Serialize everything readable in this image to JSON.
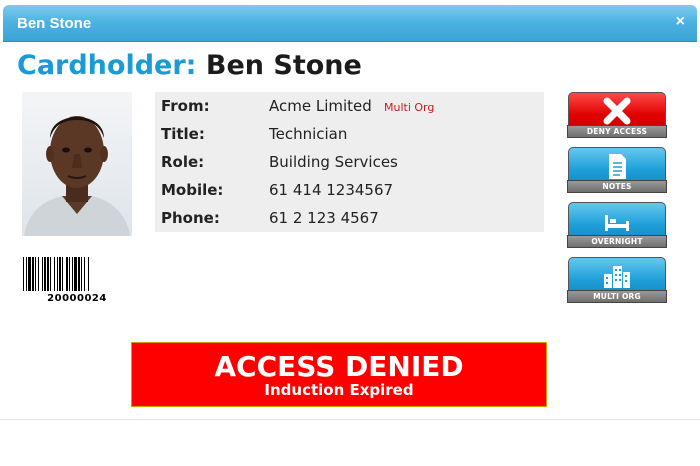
{
  "window": {
    "title": "Ben Stone",
    "close_glyph": "×"
  },
  "heading": {
    "label": "Cardholder:",
    "name": "Ben Stone"
  },
  "card": {
    "barcode_number": "20000024"
  },
  "details": [
    {
      "key": "From:",
      "value": "Acme Limited",
      "tag": "Multi Org"
    },
    {
      "key": "Title:",
      "value": "Technician"
    },
    {
      "key": "Role:",
      "value": "Building Services"
    },
    {
      "key": "Mobile:",
      "value": "61 414 1234567"
    },
    {
      "key": "Phone:",
      "value": "61 2 123 4567"
    }
  ],
  "actions": [
    {
      "label": "DENY ACCESS",
      "icon": "x-icon",
      "color": "#e00000"
    },
    {
      "label": "NOTES",
      "icon": "document-icon",
      "color": "#1e9fd8"
    },
    {
      "label": "OVERNIGHT",
      "icon": "bed-icon",
      "color": "#1e9fd8"
    },
    {
      "label": "MULTI ORG",
      "icon": "buildings-icon",
      "color": "#1e9fd8"
    }
  ],
  "status": {
    "title": "ACCESS DENIED",
    "reason": "Induction Expired",
    "color": "#ff0000"
  }
}
